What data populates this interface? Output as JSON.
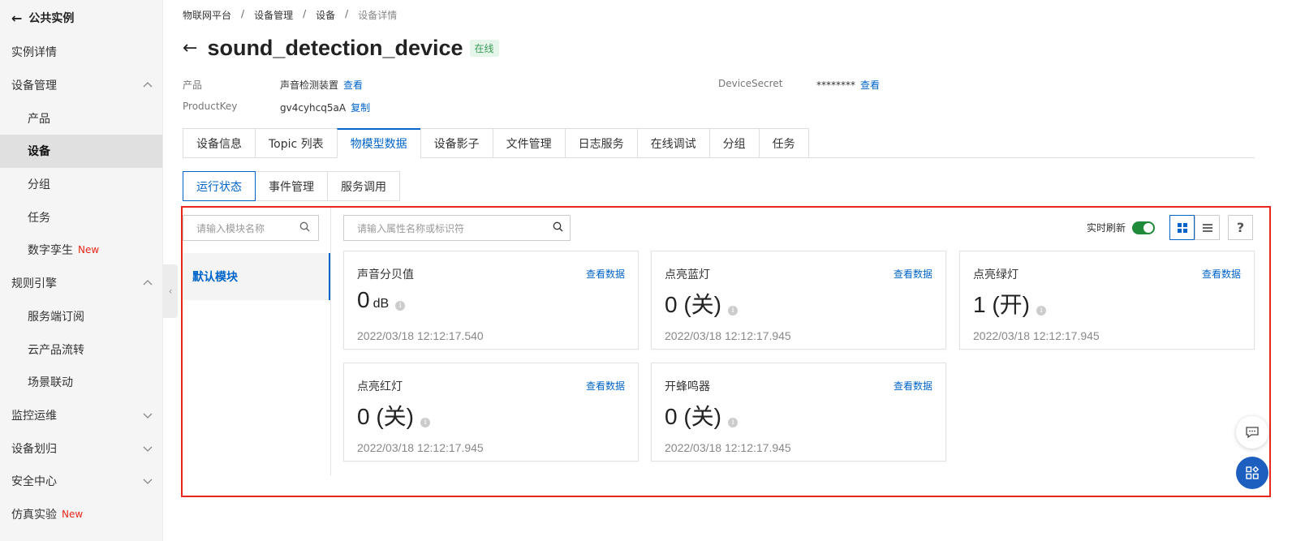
{
  "sidebar": {
    "title": "公共实例",
    "items": [
      {
        "label": "实例详情",
        "level": 0
      },
      {
        "label": "设备管理",
        "level": 0,
        "expanded": true
      },
      {
        "label": "产品",
        "level": 1
      },
      {
        "label": "设备",
        "level": 1,
        "active": true
      },
      {
        "label": "分组",
        "level": 1
      },
      {
        "label": "任务",
        "level": 1
      },
      {
        "label": "数字孪生",
        "level": 1,
        "badge": "New"
      },
      {
        "label": "规则引擎",
        "level": 0,
        "expanded": true
      },
      {
        "label": "服务端订阅",
        "level": 1
      },
      {
        "label": "云产品流转",
        "level": 1
      },
      {
        "label": "场景联动",
        "level": 1
      },
      {
        "label": "监控运维",
        "level": 0,
        "expanded": false
      },
      {
        "label": "设备划归",
        "level": 0,
        "expanded": false
      },
      {
        "label": "安全中心",
        "level": 0,
        "expanded": false
      },
      {
        "label": "仿真实验",
        "level": 0,
        "badge": "New"
      }
    ]
  },
  "breadcrumb": [
    "物联网平台",
    "设备管理",
    "设备",
    "设备详情"
  ],
  "device": {
    "name": "sound_detection_device",
    "status": "在线",
    "product_label": "产品",
    "product_value": "声音检测装置",
    "product_link": "查看",
    "productkey_label": "ProductKey",
    "productkey_value": "gv4cyhcq5aA",
    "productkey_link": "复制",
    "secret_label": "DeviceSecret",
    "secret_value": "********",
    "secret_link": "查看"
  },
  "tabs": [
    "设备信息",
    "Topic 列表",
    "物模型数据",
    "设备影子",
    "文件管理",
    "日志服务",
    "在线调试",
    "分组",
    "任务"
  ],
  "active_tab": 2,
  "subtabs": [
    "运行状态",
    "事件管理",
    "服务调用"
  ],
  "active_subtab": 0,
  "module_search_placeholder": "请输入模块名称",
  "module_item": "默认模块",
  "property_search_placeholder": "请输入属性名称或标识符",
  "realtime_label": "实时刷新",
  "realtime_on": true,
  "colors": {
    "accent": "#0064c8",
    "highlight_border": "#e8261b",
    "online": "#3a9b57",
    "new_badge": "#e8261b"
  },
  "cards": [
    {
      "name": "声音分贝值",
      "link": "查看数据",
      "value": "0",
      "unit": "dB",
      "time": "2022/03/18 12:12:17.540"
    },
    {
      "name": "点亮蓝灯",
      "link": "查看数据",
      "value": "0 (关)",
      "unit": "",
      "time": "2022/03/18 12:12:17.945"
    },
    {
      "name": "点亮绿灯",
      "link": "查看数据",
      "value": "1 (开)",
      "unit": "",
      "time": "2022/03/18 12:12:17.945"
    },
    {
      "name": "点亮红灯",
      "link": "查看数据",
      "value": "0 (关)",
      "unit": "",
      "time": "2022/03/18 12:12:17.945"
    },
    {
      "name": "开蜂鸣器",
      "link": "查看数据",
      "value": "0 (关)",
      "unit": "",
      "time": "2022/03/18 12:12:17.945"
    }
  ]
}
